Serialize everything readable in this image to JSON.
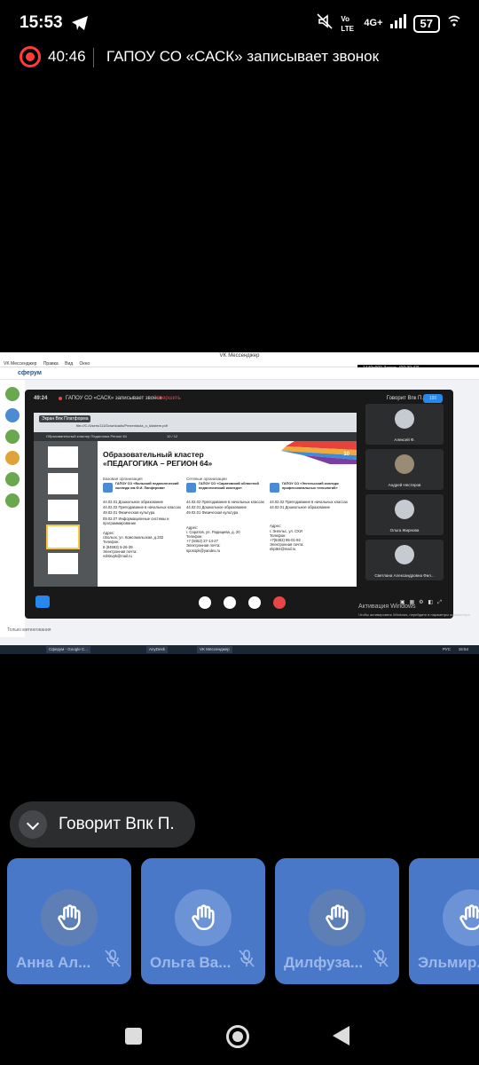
{
  "status_bar": {
    "time": "15:53",
    "net_top": "4G+",
    "net_vo": "Vo LTE",
    "battery": "57"
  },
  "recording": {
    "elapsed": "40:46",
    "text": "ГАПОУ СО «САСК» записывает звонок"
  },
  "desktop": {
    "window_title": "VK Мессенджер",
    "menu": [
      "VK Мессенджер",
      "Правка",
      "Вид",
      "Окно"
    ],
    "vk_logo": "сферум",
    "overlay": "1440x900   Запись [00:30:43]",
    "call": {
      "time": "49:24",
      "rec_text": "ГАПОУ СО «САСК» записывает звонок",
      "stop": "Завершить",
      "speaks": "Говорит Впк П.",
      "count": "100",
      "screen_badge": "Экран Впк Платформа",
      "url": "file:///C:/Users/111/Downloads/Prezentacia_o_klastere.pdf",
      "pdf_name": "Образовательный кластер Педагогика Регион 64",
      "pdf_page": "10 / 12",
      "slide": {
        "title1": "Образовательный кластер",
        "title2": "«ПЕДАГОГИКА – РЕГИОН 64»",
        "num": "10",
        "head_left": "Базовая организация",
        "head_right": "Сетевые организации",
        "cols": [
          {
            "org": "ГАПОУ СО «Вольский педагогический колледж им.Ф.И. Панферова»",
            "specs": [
              "44.02.01 Дошкольное образование",
              "44.02.02 Преподавание в начальных классах",
              "49.02.01 Физическая культура",
              "09.02.07 Информационные системы и программирование"
            ],
            "addr_label": "Адрес:",
            "addr": "г.Вольск, ул. Комсомольская, д.202",
            "tel_label": "Телефон:",
            "tel": "8 (84593) 5-26-39",
            "mail_label": "Электронная почта:",
            "mail": "volskvpk@mail.ru"
          },
          {
            "org": "ГАПОУ СО «Саратовский областной педагогический колледж»",
            "specs": [
              "44.02.02 Преподавание в начальных классах",
              "44.02.01 Дошкольное образование",
              "49.02.01 Физическая культура"
            ],
            "addr_label": "Адрес:",
            "addr": "г. Саратов, ул. Радищева, д. 20",
            "tel_label": "Телефон:",
            "tel": "+7 (8452) 27-14-27",
            "mail_label": "Электронная почта:",
            "mail": "sposopk@yandex.ru"
          },
          {
            "org": "ГАПОУ СО «Энгельсский колледж профессиональных технологий»",
            "specs": [
              "44.02.02 Преподавание в начальных классах",
              "44.02.01 Дошкольное образование"
            ],
            "addr_label": "Адрес:",
            "addr": "г. Энгельс, ул. СХИ",
            "tel_label": "Телефон:",
            "tel": "+7(8453) 95-01-92",
            "mail_label": "Электронная почта:",
            "mail": "ekpt64@mail.ru"
          }
        ]
      },
      "participants": [
        "Алексей Ф.",
        "Андрей Нестеров",
        "Ольга Жирнова",
        "Светлана Александровна Фил..."
      ]
    },
    "activate": "Активация Windows",
    "activate_sub": "Чтобы активировать Windows, перейдите в параметры компьютера.",
    "input_placeholder": "Только митингования",
    "taskbar": {
      "items": [
        "Сферум - Google C...",
        "AnyDesk",
        "VK Мессенджер"
      ],
      "lang": "РУС",
      "time": "15:54"
    }
  },
  "speaking": "Говорит Впк П.",
  "cards": [
    {
      "name": "Анна Ал..."
    },
    {
      "name": "Ольга Ва..."
    },
    {
      "name": "Дилфуза..."
    },
    {
      "name": "Эльмир..."
    }
  ]
}
